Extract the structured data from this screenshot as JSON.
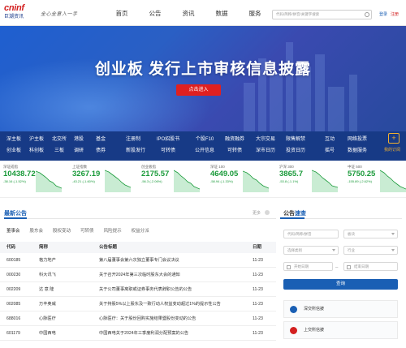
{
  "header": {
    "logo_mark": "cninf",
    "logo_sub": "巨潮资讯",
    "slogan": "全心全意入一手",
    "nav": [
      "首页",
      "公告",
      "资讯",
      "数据",
      "服务"
    ],
    "search_placeholder": "代码/简称/拼音/关键字搜索",
    "login": "登录",
    "register": "注册"
  },
  "banner": {
    "title": "创业板 发行上市审核信息披露",
    "button": "点击进入"
  },
  "quick": {
    "row1": [
      "深主板",
      "沪主板",
      "北交所",
      "港股",
      "基金",
      "注册制",
      "IPO招股书",
      "个股F10",
      "融资融券",
      "大宗交易",
      "限售解禁",
      "互动",
      "网络投票"
    ],
    "row2": [
      "创业板",
      "科创板",
      "三板",
      "调研",
      "债券",
      "新股发行",
      "可转债",
      "公开信息",
      "可转债",
      "深市日历",
      "投资日历",
      "摇号",
      "数据服务"
    ],
    "my_label": "我的订阅"
  },
  "indices": [
    {
      "name": "深证成指",
      "value": "10438.72",
      "change": "-38.16 (-1.52%)",
      "dir": "down"
    },
    {
      "name": "上证指数",
      "value": "3267.19",
      "change": "-43.21 (-1.60%)",
      "dir": "down"
    },
    {
      "name": "创业板指",
      "value": "2175.57",
      "change": "-56.3 (-2.06%)",
      "dir": "down"
    },
    {
      "name": "深证 100",
      "value": "4649.05",
      "change": "-58.94 (-1.33%)",
      "dir": "down"
    },
    {
      "name": "沪深 300",
      "value": "3865.7",
      "change": "-53.8 (-1.1%)",
      "dir": "down"
    },
    {
      "name": "中证 500",
      "value": "5750.25",
      "change": "-155.89 (-2.62%)",
      "dir": "down"
    }
  ],
  "announcements": {
    "title": "最新公告",
    "more": "更多",
    "tabs": [
      "董事会",
      "股东会",
      "股权变动",
      "可转债",
      "风险提示",
      "权益分派"
    ],
    "columns": [
      "代码",
      "简称",
      "公告标题",
      "日期"
    ],
    "rows": [
      {
        "code": "600185",
        "name": "格力地产",
        "title": "第八届董事会第六次独立董事专门会议决议",
        "date": "11-23"
      },
      {
        "code": "000230",
        "name": "科大讯飞",
        "title": "关于召开2024年第三次临时股东大会的通知",
        "date": "11-23"
      },
      {
        "code": "002209",
        "name": "达 意 隆",
        "title": "关于公司董事离职或证券事务代表辞职公告的公告",
        "date": "11-23"
      },
      {
        "code": "002085",
        "name": "万丰奥威",
        "title": "关于持股5%以上股东及一致行动人权益变动超过1%的提示性公告",
        "date": "11-23"
      },
      {
        "code": "688016",
        "name": "心脉医疗",
        "title": "心脉医疗：关于股份回购实施结果暨股份变动的公告",
        "date": "11-23"
      },
      {
        "code": "601179",
        "name": "中国西电",
        "title": "中国西电关于2024年三季度利润分配预案的公告",
        "date": "11-23"
      }
    ]
  },
  "query": {
    "title_a": "公告",
    "title_b": "速查",
    "code_placeholder": "代码/简称/拼音",
    "plate_placeholder": "板块",
    "category_placeholder": "选择类别",
    "industry_placeholder": "行业",
    "start_date": "开始日期",
    "end_date": "结束日期",
    "dash": "–",
    "button": "查询"
  },
  "side_links": [
    {
      "label": "深交所信披",
      "color": "#1a5fb4"
    },
    {
      "label": "上交所信披",
      "color": "#d32020"
    }
  ]
}
